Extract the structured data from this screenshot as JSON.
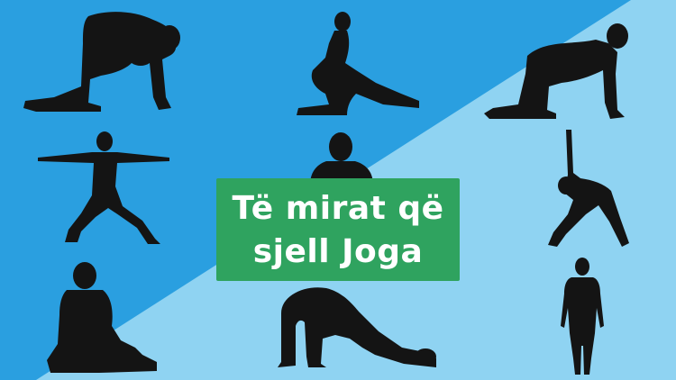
{
  "title": {
    "line1": "Të mirat që",
    "line2": "sjell Joga"
  },
  "colors": {
    "background_dark_blue": "#2a9fe0",
    "background_light_blue": "#8fd3f2",
    "silhouette": "#141414",
    "title_box": "#2fa35f",
    "title_text": "#ffffff"
  },
  "illustration": {
    "poses": [
      "cat-pose",
      "low-lunge-pose",
      "cow-pose",
      "warrior-pose",
      "lotus-meditation-pose",
      "triangle-pose",
      "seated-twist-pose",
      "bridge-pose",
      "mountain-pose"
    ]
  }
}
